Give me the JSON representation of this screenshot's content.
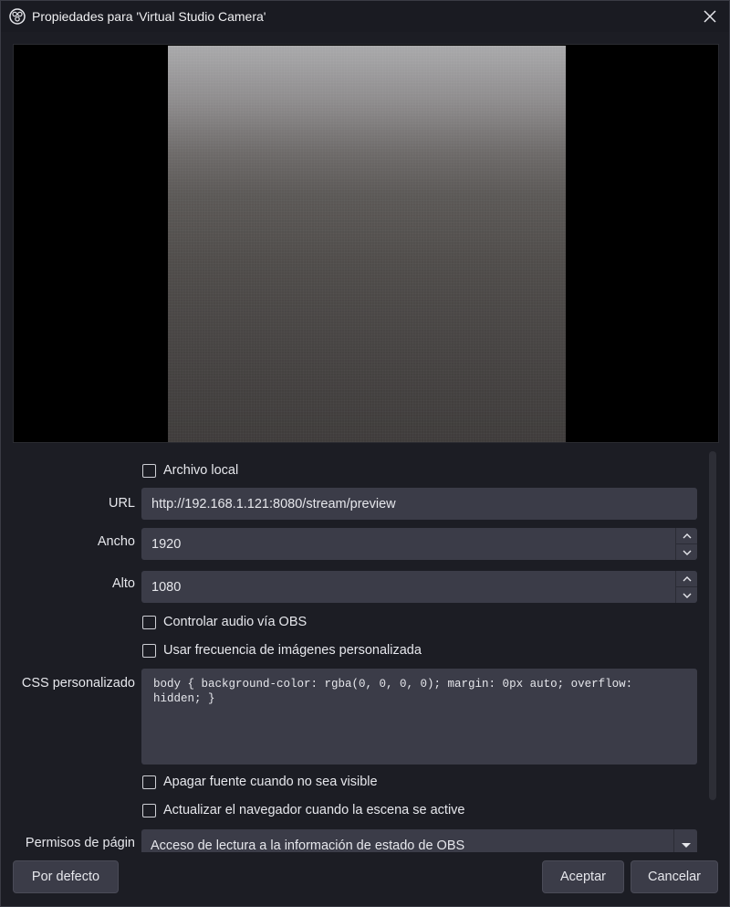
{
  "window": {
    "title": "Propiedades para 'Virtual Studio Camera'"
  },
  "icons": {
    "app": "obs-logo-icon",
    "close": "close-icon",
    "spin_up": "chevron-up-icon",
    "spin_down": "chevron-down-icon",
    "select": "triangle-down-icon"
  },
  "form": {
    "local_file": {
      "label": "Archivo local",
      "checked": false
    },
    "url": {
      "label": "URL",
      "value": "http://192.168.1.121:8080/stream/preview"
    },
    "width": {
      "label": "Ancho",
      "value": "1920"
    },
    "height": {
      "label": "Alto",
      "value": "1080"
    },
    "control_audio": {
      "label": "Controlar audio vía OBS",
      "checked": false
    },
    "custom_fps": {
      "label": "Usar frecuencia de imágenes personalizada",
      "checked": false
    },
    "css": {
      "label": "CSS personalizado",
      "value": "body { background-color: rgba(0, 0, 0, 0); margin: 0px auto; overflow:\nhidden; }"
    },
    "shutdown_hidden": {
      "label": "Apagar fuente cuando no sea visible",
      "checked": false
    },
    "refresh_active": {
      "label": "Actualizar el navegador cuando la escena se active",
      "checked": false
    },
    "permissions": {
      "label": "Permisos de págin",
      "value": "Acceso de lectura a la información de estado de OBS"
    }
  },
  "buttons": {
    "defaults": "Por defecto",
    "ok": "Aceptar",
    "cancel": "Cancelar"
  },
  "colors": {
    "background": "#1c1d24",
    "field": "#3b3c48",
    "text": "#e6e7ec"
  }
}
